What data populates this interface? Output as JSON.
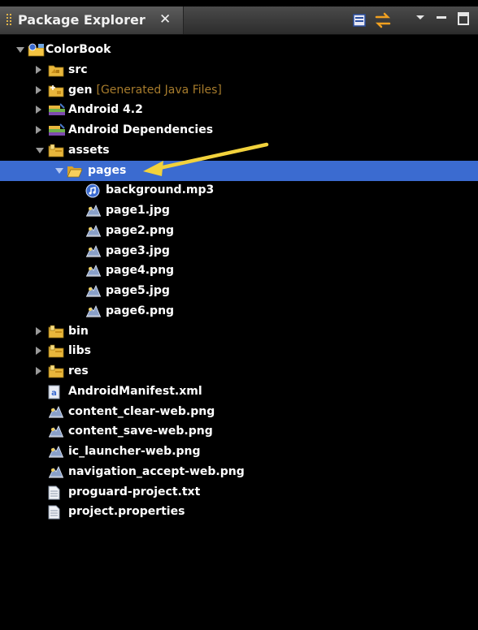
{
  "view": {
    "title": "Package Explorer",
    "close_glyph": "✕"
  },
  "toolbar": {
    "icons": [
      "collapse-all-icon",
      "link-with-editor-icon",
      "view-menu-icon",
      "minimize-icon",
      "maximize-icon"
    ]
  },
  "tree": {
    "items": [
      {
        "label": "ColorBook",
        "level": 0,
        "toggle": "expanded",
        "icon": "android-project-icon"
      },
      {
        "label": "src",
        "level": 1,
        "toggle": "collapsed",
        "icon": "source-folder-icon"
      },
      {
        "label": "gen",
        "decoration": "[Generated Java Files]",
        "level": 1,
        "toggle": "collapsed",
        "icon": "gen-folder-icon"
      },
      {
        "label": "Android 4.2",
        "level": 1,
        "toggle": "collapsed",
        "icon": "library-icon"
      },
      {
        "label": "Android Dependencies",
        "level": 1,
        "toggle": "collapsed",
        "icon": "library-icon"
      },
      {
        "label": "assets",
        "level": 1,
        "toggle": "expanded",
        "icon": "folder-icon"
      },
      {
        "label": "pages",
        "level": 2,
        "toggle": "expanded",
        "icon": "open-folder-icon",
        "selected": true
      },
      {
        "label": "background.mp3",
        "level": 3,
        "toggle": "none",
        "icon": "audio-file-icon"
      },
      {
        "label": "page1.jpg",
        "level": 3,
        "toggle": "none",
        "icon": "image-file-icon"
      },
      {
        "label": "page2.png",
        "level": 3,
        "toggle": "none",
        "icon": "image-file-icon"
      },
      {
        "label": "page3.jpg",
        "level": 3,
        "toggle": "none",
        "icon": "image-file-icon"
      },
      {
        "label": "page4.png",
        "level": 3,
        "toggle": "none",
        "icon": "image-file-icon"
      },
      {
        "label": "page5.jpg",
        "level": 3,
        "toggle": "none",
        "icon": "image-file-icon"
      },
      {
        "label": "page6.png",
        "level": 3,
        "toggle": "none",
        "icon": "image-file-icon"
      },
      {
        "label": "bin",
        "level": 1,
        "toggle": "collapsed",
        "icon": "folder-icon"
      },
      {
        "label": "libs",
        "level": 1,
        "toggle": "collapsed",
        "icon": "folder-icon"
      },
      {
        "label": "res",
        "level": 1,
        "toggle": "collapsed",
        "icon": "folder-icon"
      },
      {
        "label": "AndroidManifest.xml",
        "level": 1,
        "toggle": "none",
        "icon": "xml-file-icon"
      },
      {
        "label": "content_clear-web.png",
        "level": 1,
        "toggle": "none",
        "icon": "image-file-icon"
      },
      {
        "label": "content_save-web.png",
        "level": 1,
        "toggle": "none",
        "icon": "image-file-icon"
      },
      {
        "label": "ic_launcher-web.png",
        "level": 1,
        "toggle": "none",
        "icon": "image-file-icon"
      },
      {
        "label": "navigation_accept-web.png",
        "level": 1,
        "toggle": "none",
        "icon": "image-file-icon"
      },
      {
        "label": "proguard-project.txt",
        "level": 1,
        "toggle": "none",
        "icon": "text-file-icon"
      },
      {
        "label": "project.properties",
        "level": 1,
        "toggle": "none",
        "icon": "text-file-icon"
      }
    ]
  },
  "colors": {
    "selection": "#3b6bd0",
    "background": "#000000",
    "decoration": "#a67b2c",
    "annotation_arrow": "#f2d23c"
  }
}
